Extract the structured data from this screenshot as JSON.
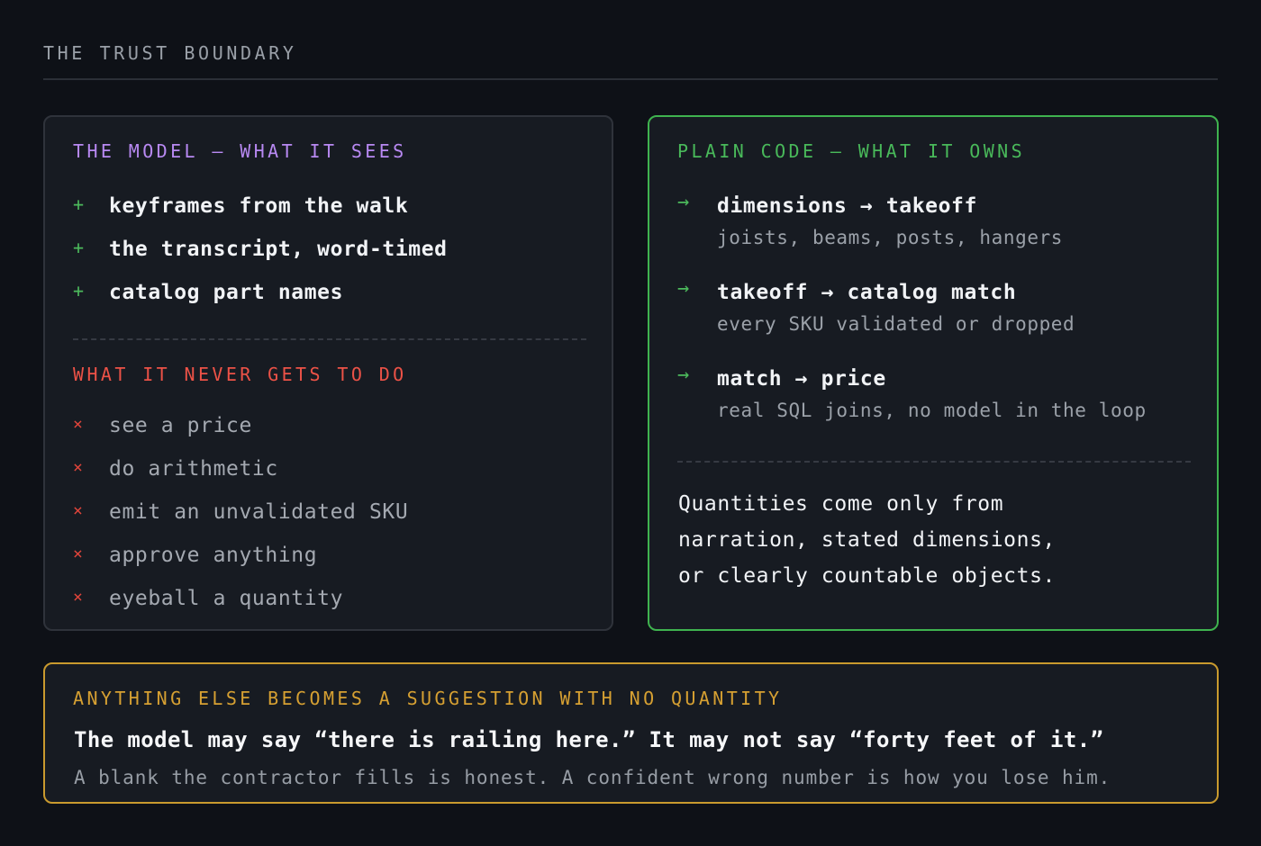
{
  "header": {
    "title": "THE TRUST BOUNDARY"
  },
  "model_panel": {
    "sees_title": "THE MODEL — WHAT IT SEES",
    "sees_items": [
      "keyframes from the walk",
      "the transcript, word-timed",
      "catalog part names"
    ],
    "never_title": "WHAT IT NEVER GETS TO DO",
    "never_items": [
      "see a price",
      "do arithmetic",
      "emit an unvalidated SKU",
      "approve anything",
      "eyeball a quantity"
    ],
    "plus_icon": "+",
    "cross_icon": "×"
  },
  "code_panel": {
    "title": "PLAIN CODE — WHAT IT OWNS",
    "arrow_icon": "→",
    "steps": [
      {
        "label": "dimensions → takeoff",
        "detail": "joists, beams, posts, hangers"
      },
      {
        "label": "takeoff → catalog match",
        "detail": "every SKU validated or dropped"
      },
      {
        "label": "match → price",
        "detail": "real SQL joins, no model in the loop"
      }
    ],
    "statement_lines": [
      "Quantities come only from",
      "narration, stated dimensions,",
      "or clearly countable objects."
    ]
  },
  "rule_panel": {
    "title": "ANYTHING ELSE BECOMES A SUGGESTION WITH NO QUANTITY",
    "quote": "The model may say “there is railing here.” It may not say “forty feet of it.”",
    "note": "A blank the contractor fills is honest. A confident wrong number is how you lose him."
  },
  "colors": {
    "background": "#0e1117",
    "panel": "#171b22",
    "model_accent": "#b889f2",
    "never_accent": "#ec5247",
    "code_accent": "#49b95a",
    "rule_accent": "#d6a032"
  }
}
